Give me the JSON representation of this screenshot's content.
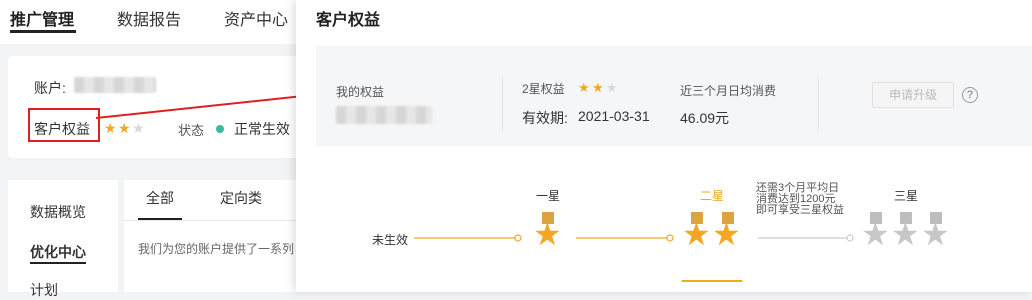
{
  "top_nav": {
    "tabs": [
      "推广管理",
      "数据报告",
      "资产中心"
    ]
  },
  "account_card": {
    "account_label": "账户:",
    "rights_label": "客户权益",
    "rights_stars": 2,
    "rights_stars_max": 3,
    "status_label": "状态",
    "status_value": "正常生效",
    "status_color": "#3bb89a"
  },
  "sidebar": {
    "items": [
      "数据概览",
      "优化中心",
      "计划"
    ]
  },
  "content": {
    "tabs": [
      "全部",
      "定向类"
    ],
    "description": "我们为您的账户提供了一系列"
  },
  "panel": {
    "title": "客户权益",
    "my_rights_label": "我的权益",
    "level_label": "2星权益",
    "level_stars": 2,
    "validity_label": "有效期:",
    "validity_value": "2021-03-31",
    "avg_spend_label": "近三个月日均消费",
    "avg_spend_value": "46.09元",
    "upgrade_button": "申请升级",
    "help_icon_glyph": "?",
    "accent_color": "#f5a623"
  },
  "levels": {
    "inactive_label": "未生效",
    "items": [
      {
        "label": "一星",
        "stars": 1,
        "state": "achieved"
      },
      {
        "label": "二星",
        "stars": 2,
        "state": "current"
      },
      {
        "label": "三星",
        "stars": 3,
        "state": "locked"
      }
    ],
    "upgrade_note": [
      "还需3个月平均日",
      "消费达到1200元",
      "即可享受三星权益"
    ]
  }
}
